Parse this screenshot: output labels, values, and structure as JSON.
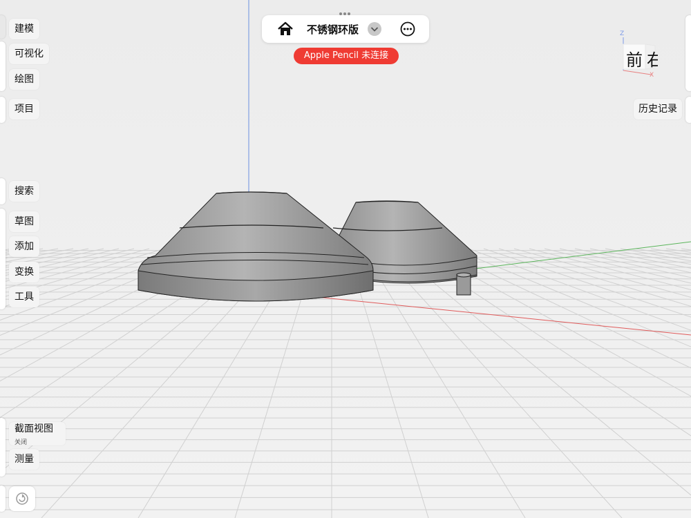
{
  "toolbar": {
    "title": "不锈钢环版",
    "home_icon": "home-icon",
    "dropdown_icon": "chevron-down-icon",
    "more_icon": "more-icon"
  },
  "status": {
    "pencil": "Apple Pencil 未连接",
    "pencil_color": "#ef3b33"
  },
  "sidebar": {
    "group1": [
      "建模",
      "可视化",
      "绘图"
    ],
    "group2": [
      "项目"
    ],
    "group3": [
      "搜索"
    ],
    "group4": [
      "草图",
      "添加",
      "变换",
      "工具"
    ],
    "section_view": {
      "label": "截面视图",
      "state": "关闭"
    },
    "measure": "测量"
  },
  "right": {
    "history": "历史记录",
    "viewcube": {
      "front": "前",
      "right": "右",
      "axis_z": "Z",
      "axis_x": "X"
    }
  },
  "axes": {
    "x_color": "#e05a5a",
    "y_color": "#5ab55a",
    "z_color": "#6a8fe0"
  }
}
